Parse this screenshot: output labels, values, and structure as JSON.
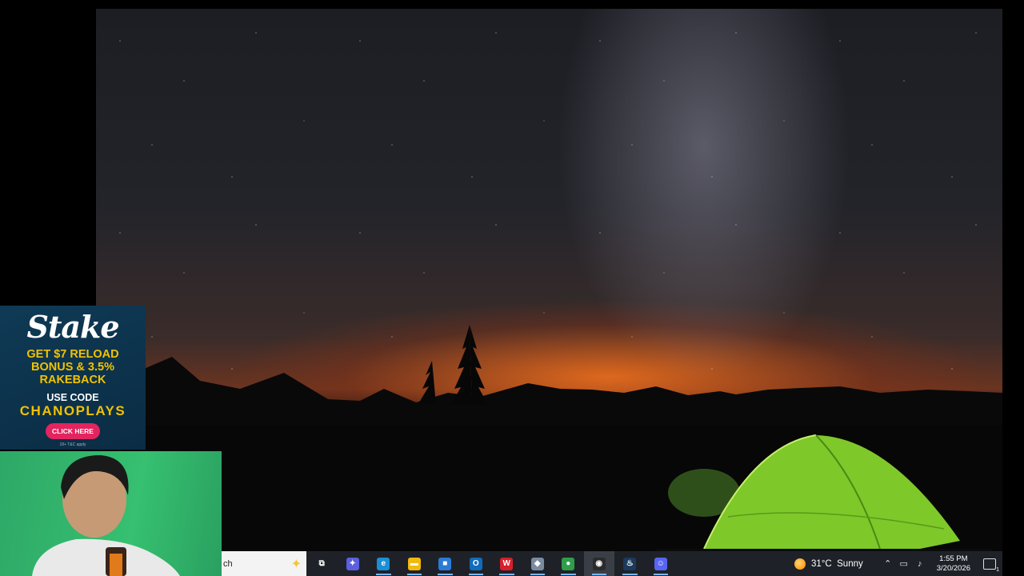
{
  "ad": {
    "brand": "Stake",
    "offer_line1": "GET $7 RELOAD",
    "offer_line2": "BONUS & 3.5%",
    "offer_line3": "RAKEBACK",
    "use_code_label": "USE CODE",
    "code": "CHANOPLAYS",
    "cta": "CLICK HERE",
    "fine_print": "18+ T&C apply"
  },
  "taskbar": {
    "search_text": "ch",
    "apps": [
      {
        "name": "task-view",
        "glyph": "⧉",
        "color": "#1e2228"
      },
      {
        "name": "copilot",
        "glyph": "✦",
        "color": "#5b5fe0"
      },
      {
        "name": "edge",
        "glyph": "e",
        "color": "#1b8fd6"
      },
      {
        "name": "file-explorer",
        "glyph": "▬",
        "color": "#f2b90f"
      },
      {
        "name": "microsoft-store",
        "glyph": "■",
        "color": "#2b7bd6"
      },
      {
        "name": "outlook",
        "glyph": "O",
        "color": "#0f6cbd"
      },
      {
        "name": "wps-office",
        "glyph": "W",
        "color": "#d71f2b"
      },
      {
        "name": "game-app",
        "glyph": "◆",
        "color": "#7a8aa0"
      },
      {
        "name": "chrome",
        "glyph": "●",
        "color": "#2e9e4a"
      },
      {
        "name": "obs-studio",
        "glyph": "◉",
        "color": "#2b2b2b"
      },
      {
        "name": "steam",
        "glyph": "♨",
        "color": "#1b3a5c"
      },
      {
        "name": "discord",
        "glyph": "☺",
        "color": "#5865f2"
      }
    ],
    "weather": {
      "temp": "31°C",
      "condition": "Sunny"
    },
    "clock": {
      "time": "1:55 PM",
      "date": "3/20/2026"
    },
    "notification_count": "1"
  }
}
